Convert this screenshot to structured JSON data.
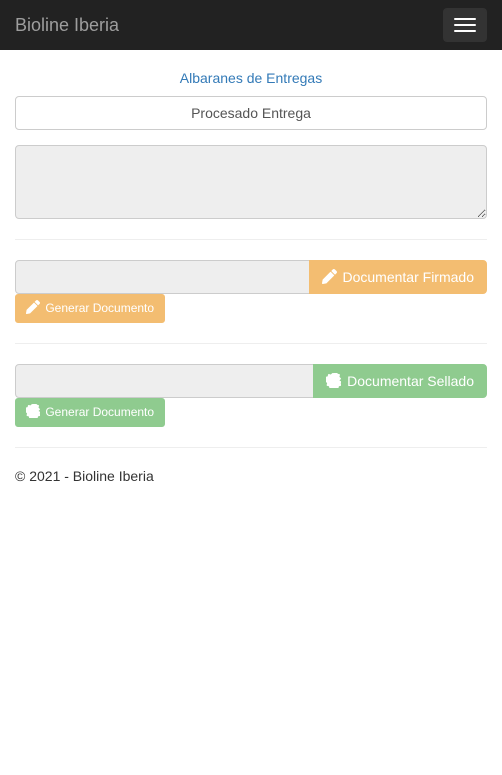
{
  "navbar": {
    "brand": "Bioline Iberia"
  },
  "page": {
    "title": "Albaranes de Entregas"
  },
  "form": {
    "procesado_value": "Procesado Entrega",
    "textarea_value": ""
  },
  "firmado": {
    "input_value": "",
    "documentar_label": "Documentar Firmado",
    "generar_label": "Generar Documento"
  },
  "sellado": {
    "input_value": "",
    "documentar_label": "Documentar Sellado",
    "generar_label": "Generar Documento"
  },
  "footer": {
    "text": "© 2021 - Bioline Iberia"
  }
}
